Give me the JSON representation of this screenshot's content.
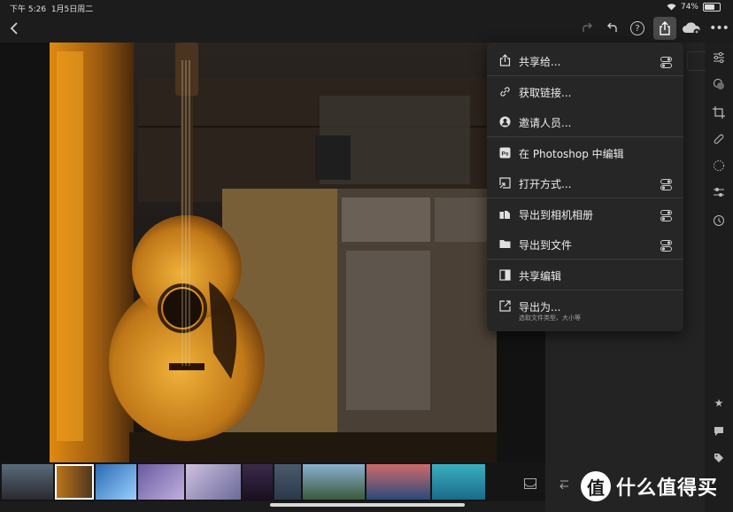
{
  "status_bar": {
    "time": "下午 5:26",
    "date": "1月5日周二",
    "battery": "74%",
    "battery_level": 0.74
  },
  "share_menu": {
    "items": [
      {
        "label": "共享给...",
        "icon": "share-icon",
        "has_toggle": true
      },
      {
        "label": "获取链接...",
        "icon": "link-icon",
        "has_toggle": false
      },
      {
        "label": "邀请人员...",
        "icon": "invite-people-icon",
        "has_toggle": false
      },
      {
        "label": "在 Photoshop 中编辑",
        "icon": "photoshop-icon",
        "has_toggle": false
      },
      {
        "label": "打开方式...",
        "icon": "open-with-icon",
        "has_toggle": true
      },
      {
        "label": "导出到相机相册",
        "icon": "camera-roll-icon",
        "has_toggle": true
      },
      {
        "label": "导出到文件",
        "icon": "folder-icon",
        "has_toggle": true
      },
      {
        "label": "共享编辑",
        "icon": "share-edits-icon",
        "has_toggle": false
      },
      {
        "label": "导出为...",
        "sublabel": "选取文件类型、大小等",
        "icon": "export-as-icon",
        "has_toggle": false
      }
    ]
  },
  "watermark": {
    "badge": "值",
    "text": "什么值得买"
  },
  "colors": {
    "menu_bg": "#262626",
    "toolbar_bg": "#1d1d1d",
    "active_button": "#4a4a4a"
  }
}
